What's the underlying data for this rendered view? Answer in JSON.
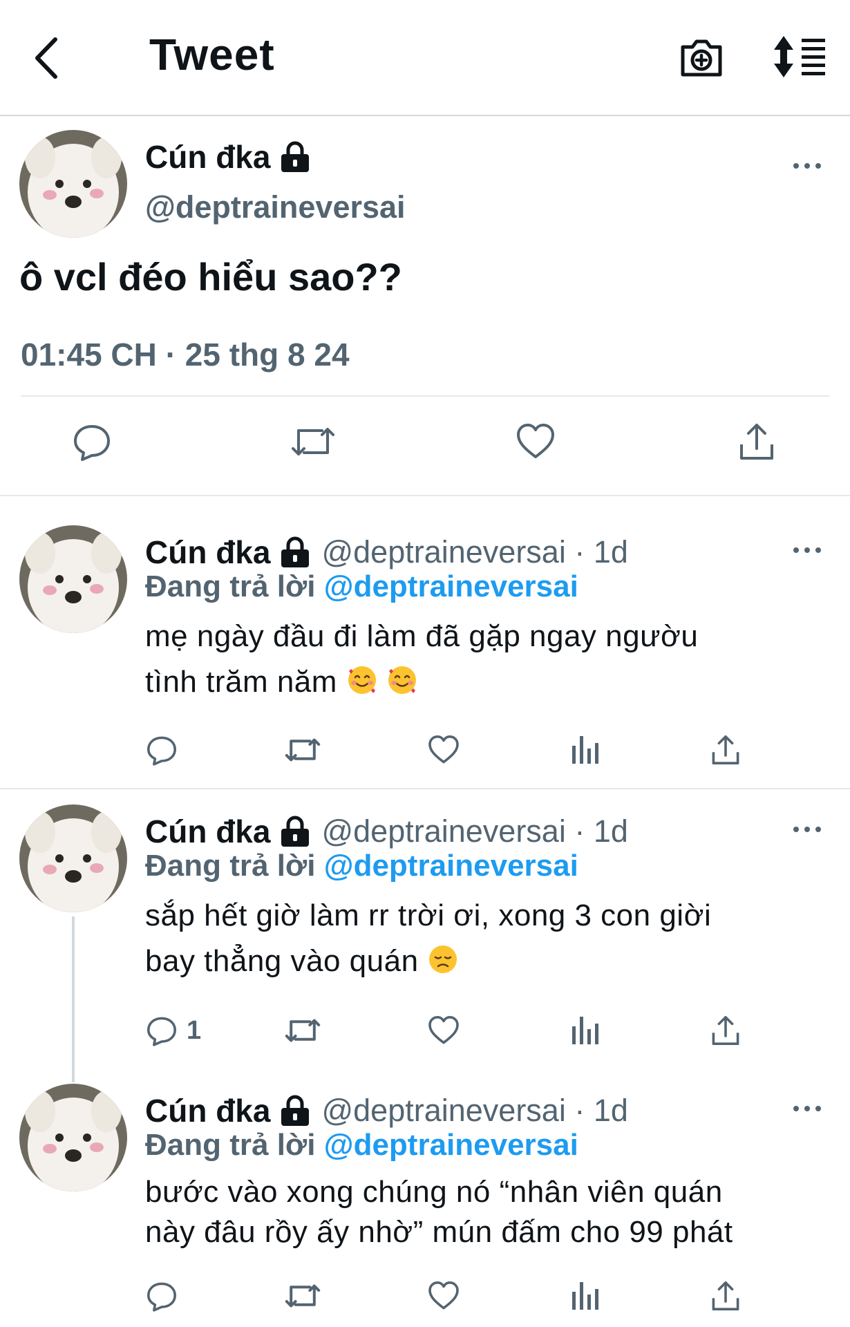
{
  "header": {
    "title": "Tweet",
    "back_icon": "chevron-left-icon",
    "camera_icon": "camera-plus-icon",
    "sort_icon": "sort-list-icon"
  },
  "main_tweet": {
    "name": "Cún đka",
    "handle": "@deptraineversai",
    "text": "ô vcl đéo hiểu sao??",
    "timestamp": "01:45 CH · 25 thg 8 24"
  },
  "replies": [
    {
      "name": "Cún đka",
      "handle": "@deptraineversai · 1d",
      "replying_prefix": "Đang trả lời",
      "replying_mention": "@deptraineversai",
      "text_lines": [
        "mẹ ngày đầu đi làm đã gặp ngay ngườu",
        "tình trăm năm"
      ],
      "reply_count": ""
    },
    {
      "name": "Cún đka",
      "handle": "@deptraineversai · 1d",
      "replying_prefix": "Đang trả lời",
      "replying_mention": "@deptraineversai",
      "text_lines": [
        "sắp hết giờ làm rr trời ơi, xong 3 con giời",
        "bay thẳng vào quán"
      ],
      "reply_count": "1"
    },
    {
      "name": "Cún đka",
      "handle": "@deptraineversai · 1d",
      "replying_prefix": "Đang trả lời",
      "replying_mention": "@deptraineversai",
      "text_lines": [
        "bước vào xong chúng nó “nhân viên quán",
        "này đâu rồy ấy nhờ” mún đấm cho 99 phát"
      ],
      "reply_count": ""
    }
  ],
  "colors": {
    "accent": "#1d9bf0",
    "secondary_text": "#536471",
    "divider": "#e6e8ea"
  }
}
